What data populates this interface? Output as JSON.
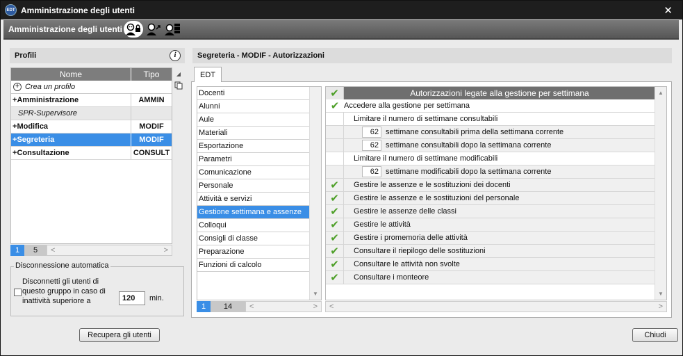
{
  "window": {
    "logo": "EDT",
    "title": "Amministrazione degli utenti",
    "close": "✕"
  },
  "header": {
    "title": "Amministrazione degli utenti",
    "icons": [
      "users-lock-icon",
      "user-swap-icon",
      "user-server-icon"
    ]
  },
  "profiles": {
    "title": "Profili",
    "col_name": "Nome",
    "col_type": "Tipo",
    "create_label": "Crea un profilo",
    "rows": [
      {
        "name": "Amministrazione",
        "type": "AMMIN",
        "prefix": "+"
      },
      {
        "name": "SPR-Supervisore",
        "type": "",
        "prefix": ""
      },
      {
        "name": "Modifica",
        "type": "MODIF",
        "prefix": "+"
      },
      {
        "name": "Segreteria",
        "type": "MODIF",
        "prefix": "+",
        "selected": true
      },
      {
        "name": "Consultazione",
        "type": "CONSULT",
        "prefix": "+"
      }
    ],
    "pager": {
      "current": "1",
      "total": "5"
    }
  },
  "disconnect": {
    "title": "Disconnessione automatica",
    "text": "Disconnetti gli utenti di questo gruppo in caso di inattività superiore a",
    "value": "120",
    "unit": "min."
  },
  "recover_button": "Recupera gli utenti",
  "close_button": "Chiudi",
  "right": {
    "title": "Segreteria - MODIF - Autorizzazioni",
    "tab": "EDT",
    "categories": [
      "Docenti",
      "Alunni",
      "Aule",
      "Materiali",
      "Esportazione",
      "Parametri",
      "Comunicazione",
      "Personale",
      "Attività e servizi",
      "Gestione settimana e assenze",
      "Colloqui",
      "Consigli di classe",
      "Preparazione",
      "Funzioni di calcolo"
    ],
    "selected_category": "Gestione settimana e assenze",
    "cat_pager": {
      "current": "1",
      "total": "14"
    },
    "perm_header": "Autorizzazioni legate alla gestione per settimana",
    "permissions": [
      {
        "label": "Accedere alla gestione per settimana",
        "checked": true
      },
      {
        "label": "Limitare il numero di settimane consultabili",
        "checked": false
      },
      {
        "label": "settimane consultabili prima della settimana corrente",
        "number": "62"
      },
      {
        "label": "settimane consultabili dopo la settimana corrente",
        "number": "62"
      },
      {
        "label": "Limitare il numero di settimane modificabili",
        "checked": false
      },
      {
        "label": "settimane modificabili dopo la settimana corrente",
        "number": "62"
      },
      {
        "label": "Gestire le assenze e le sostituzioni dei docenti",
        "checked": true
      },
      {
        "label": "Gestire le assenze e le sostituzioni del personale",
        "checked": true
      },
      {
        "label": "Gestire le assenze delle classi",
        "checked": true
      },
      {
        "label": "Gestire le attività",
        "checked": true
      },
      {
        "label": "Gestire i promemoria delle attività",
        "checked": true
      },
      {
        "label": "Consultare il riepilogo delle sostituzioni",
        "checked": true
      },
      {
        "label": "Consultare le attività non svolte",
        "checked": true
      },
      {
        "label": "Consultare i monteore",
        "checked": true
      }
    ]
  },
  "colors": {
    "accent": "#3a8ee6",
    "check": "#4fa02a",
    "titlebar": "#1e1e1e"
  }
}
